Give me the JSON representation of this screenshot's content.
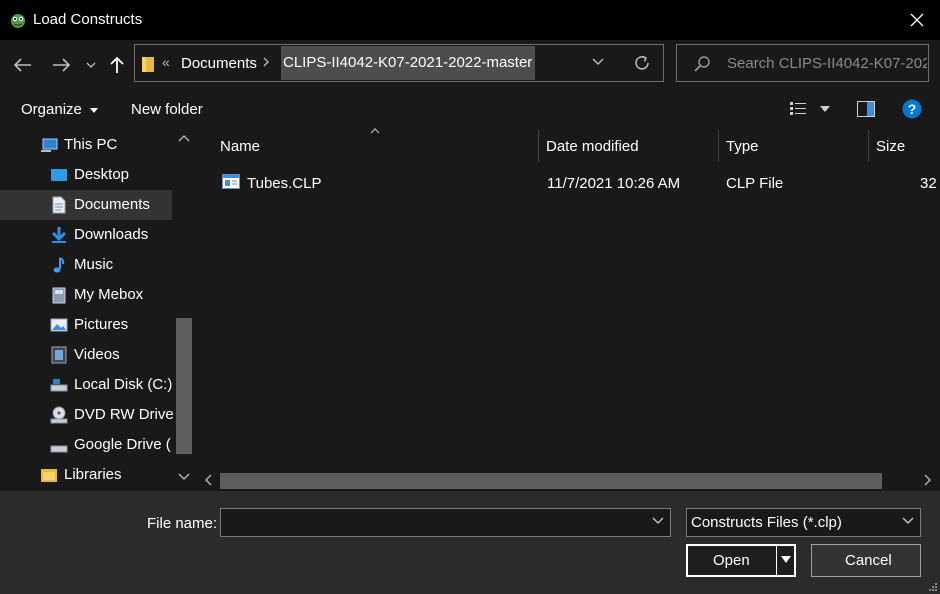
{
  "window": {
    "title": "Load Constructs"
  },
  "address": {
    "overflow": "«",
    "crumbs": [
      "Documents",
      "CLIPS-II4042-K07-2021-2022-master"
    ]
  },
  "search": {
    "placeholder": "Search CLIPS-II4042-K07-202..."
  },
  "toolbar": {
    "organize": "Organize",
    "new_folder": "New folder"
  },
  "sidebar": {
    "items": [
      {
        "label": "This PC",
        "icon": "pc-icon"
      },
      {
        "label": "Desktop",
        "icon": "desktop-icon"
      },
      {
        "label": "Documents",
        "icon": "documents-icon",
        "selected": true
      },
      {
        "label": "Downloads",
        "icon": "downloads-icon"
      },
      {
        "label": "Music",
        "icon": "music-icon"
      },
      {
        "label": "My Mebox",
        "icon": "mebox-icon"
      },
      {
        "label": "Pictures",
        "icon": "pictures-icon"
      },
      {
        "label": "Videos",
        "icon": "videos-icon"
      },
      {
        "label": "Local Disk (C:)",
        "icon": "local-disk-icon"
      },
      {
        "label": "DVD RW Drive",
        "icon": "dvd-drive-icon"
      },
      {
        "label": "Google Drive (",
        "icon": "google-drive-icon"
      },
      {
        "label": "Libraries",
        "icon": "libraries-icon"
      }
    ]
  },
  "columns": {
    "name": "Name",
    "date": "Date modified",
    "type": "Type",
    "size": "Size"
  },
  "files": [
    {
      "name": "Tubes.CLP",
      "date": "11/7/2021 10:26 AM",
      "type": "CLP File",
      "size": "32"
    }
  ],
  "bottom": {
    "file_name_label": "File name:",
    "file_name_value": "",
    "filter": "Constructs Files (*.clp)",
    "open": "Open",
    "cancel": "Cancel"
  },
  "colors": {
    "accent": "#0078d7",
    "selection": "#333333",
    "background": "#191919"
  }
}
